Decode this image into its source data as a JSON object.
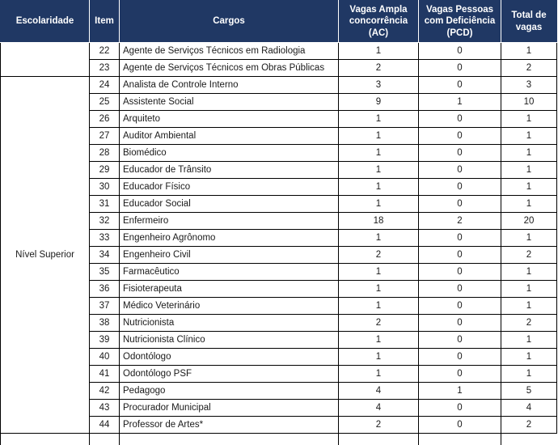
{
  "table": {
    "headers": [
      {
        "key": "escolaridade",
        "label": "Escolaridade"
      },
      {
        "key": "item",
        "label": "Item"
      },
      {
        "key": "cargos",
        "label": "Cargos"
      },
      {
        "key": "ac",
        "label": "Vagas Ampla concorrência (AC)"
      },
      {
        "key": "pcd",
        "label": "Vagas Pessoas com Deficiência (PCD)"
      },
      {
        "key": "total",
        "label": "Total de vagas"
      }
    ],
    "header_lines": {
      "ac": [
        "Vagas Ampla",
        "concorrência",
        "(AC)"
      ],
      "pcd": [
        "Vagas Pessoas",
        "com Deficiência",
        "(PCD)"
      ],
      "total": [
        "Total de",
        "vagas"
      ]
    },
    "header_bg": "#203864",
    "header_color": "#ffffff",
    "border_color": "#000000",
    "sections": [
      {
        "escolaridade": "",
        "rows": [
          {
            "item": "22",
            "cargo": "Agente de Serviços Técnicos em Radiologia",
            "ac": "1",
            "pcd": "0",
            "total": "1"
          },
          {
            "item": "23",
            "cargo": "Agente de Serviços Técnicos em Obras Públicas",
            "ac": "2",
            "pcd": "0",
            "total": "2"
          }
        ]
      },
      {
        "escolaridade": "Nível Superior",
        "rows": [
          {
            "item": "24",
            "cargo": "Analista de Controle Interno",
            "ac": "3",
            "pcd": "0",
            "total": "3"
          },
          {
            "item": "25",
            "cargo": "Assistente Social",
            "ac": "9",
            "pcd": "1",
            "total": "10"
          },
          {
            "item": "26",
            "cargo": "Arquiteto",
            "ac": "1",
            "pcd": "0",
            "total": "1"
          },
          {
            "item": "27",
            "cargo": "Auditor Ambiental",
            "ac": "1",
            "pcd": "0",
            "total": "1"
          },
          {
            "item": "28",
            "cargo": "Biomédico",
            "ac": "1",
            "pcd": "0",
            "total": "1"
          },
          {
            "item": "29",
            "cargo": "Educador de Trânsito",
            "ac": "1",
            "pcd": "0",
            "total": "1"
          },
          {
            "item": "30",
            "cargo": "Educador Físico",
            "ac": "1",
            "pcd": "0",
            "total": "1"
          },
          {
            "item": "31",
            "cargo": "Educador Social",
            "ac": "1",
            "pcd": "0",
            "total": "1"
          },
          {
            "item": "32",
            "cargo": "Enfermeiro",
            "ac": "18",
            "pcd": "2",
            "total": "20"
          },
          {
            "item": "33",
            "cargo": "Engenheiro Agrônomo",
            "ac": "1",
            "pcd": "0",
            "total": "1"
          },
          {
            "item": "34",
            "cargo": "Engenheiro Civil",
            "ac": "2",
            "pcd": "0",
            "total": "2"
          },
          {
            "item": "35",
            "cargo": "Farmacêutico",
            "ac": "1",
            "pcd": "0",
            "total": "1"
          },
          {
            "item": "36",
            "cargo": "Fisioterapeuta",
            "ac": "1",
            "pcd": "0",
            "total": "1"
          },
          {
            "item": "37",
            "cargo": "Médico Veterinário",
            "ac": "1",
            "pcd": "0",
            "total": "1"
          },
          {
            "item": "38",
            "cargo": "Nutricionista",
            "ac": "2",
            "pcd": "0",
            "total": "2"
          },
          {
            "item": "39",
            "cargo": "Nutricionista Clínico",
            "ac": "1",
            "pcd": "0",
            "total": "1"
          },
          {
            "item": "40",
            "cargo": "Odontólogo",
            "ac": "1",
            "pcd": "0",
            "total": "1"
          },
          {
            "item": "41",
            "cargo": "Odontólogo PSF",
            "ac": "1",
            "pcd": "0",
            "total": "1"
          },
          {
            "item": "42",
            "cargo": "Pedagogo",
            "ac": "4",
            "pcd": "1",
            "total": "5"
          },
          {
            "item": "43",
            "cargo": "Procurador Municipal",
            "ac": "4",
            "pcd": "0",
            "total": "4"
          },
          {
            "item": "44",
            "cargo": "Professor de Artes*",
            "ac": "2",
            "pcd": "0",
            "total": "2"
          }
        ]
      }
    ]
  }
}
